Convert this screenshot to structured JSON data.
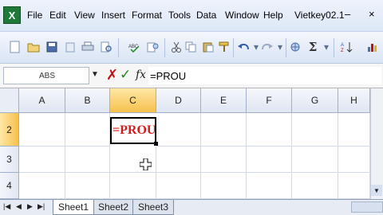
{
  "menubar": {
    "items": [
      "File",
      "Edit",
      "View",
      "Insert",
      "Format",
      "Tools",
      "Data",
      "Window",
      "Help",
      "Vietkey02.1"
    ],
    "window_buttons": [
      "–",
      "×"
    ]
  },
  "toolbar": {
    "icons": [
      "new-icon",
      "open-icon",
      "save-icon",
      "permission-icon",
      "print-icon",
      "print-preview-icon",
      "spelling-icon",
      "research-icon",
      "cut-icon",
      "copy-icon",
      "paste-icon",
      "format-painter-icon",
      "undo-icon",
      "redo-icon",
      "hyperlink-icon",
      "autosum-icon"
    ],
    "autosum_symbol": "Σ"
  },
  "formula_bar": {
    "name_box": "ABS",
    "cancel_symbol": "✗",
    "enter_symbol": "✓",
    "fx_symbol": "fx",
    "formula": "=PROU"
  },
  "grid": {
    "columns": [
      "A",
      "B",
      "C",
      "D",
      "E",
      "F",
      "G",
      "H"
    ],
    "rows": [
      "2",
      "3",
      "4"
    ],
    "active_column": "C",
    "active_row": "2",
    "active_cell_value": "=PROU"
  },
  "sheets": {
    "tabs": [
      "Sheet1",
      "Sheet2",
      "Sheet3"
    ],
    "active": "Sheet1"
  },
  "colors": {
    "active_cell_text": "#d21c1c",
    "header_highlight": "#f6c14d",
    "cancel": "#c41010",
    "enter": "#1c8a1c"
  }
}
